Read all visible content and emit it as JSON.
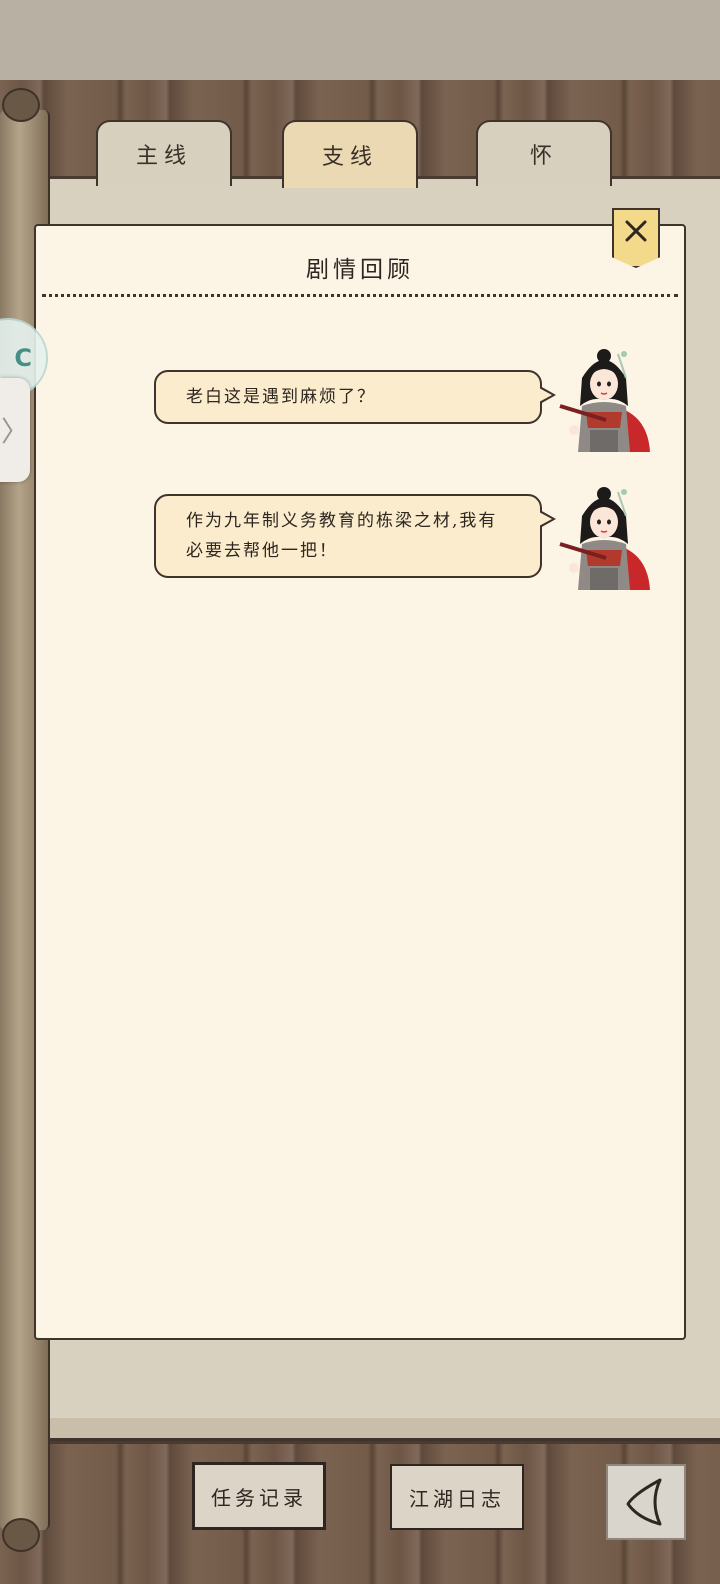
{
  "tabs": [
    {
      "label": "主线"
    },
    {
      "label": "支线",
      "active": true
    },
    {
      "label": "怀"
    }
  ],
  "panel": {
    "title": "剧情回顾",
    "close_icon": "close-icon"
  },
  "dialogs": [
    {
      "text": "老白这是遇到麻烦了？",
      "speaker_icon": "character-avatar"
    },
    {
      "text": "作为九年制义务教育的栋梁之材,我有必要去帮他一把！",
      "speaker_icon": "character-avatar"
    }
  ],
  "bottom_bar": {
    "task_record": "任务记录",
    "jianghu_log": "江湖日志",
    "back_icon": "back-arrow-icon"
  },
  "side": {
    "handle_glyph": "〉",
    "badge_text": "C"
  }
}
